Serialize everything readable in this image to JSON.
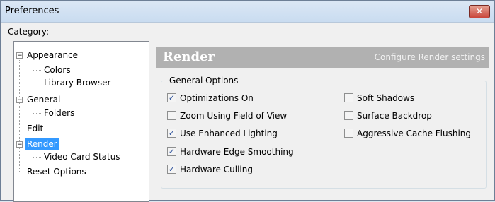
{
  "window": {
    "title": "Preferences",
    "close_glyph": "✕"
  },
  "category_label": "Category:",
  "tree": {
    "items": [
      {
        "label": "Appearance",
        "expander": "−"
      },
      {
        "label": "Colors"
      },
      {
        "label": "Library Browser"
      },
      {
        "label": "General",
        "expander": "−"
      },
      {
        "label": "Folders"
      },
      {
        "label": "Edit"
      },
      {
        "label": "Render",
        "expander": "−",
        "selected": true
      },
      {
        "label": "Video Card Status"
      },
      {
        "label": "Reset Options"
      }
    ]
  },
  "page": {
    "title": "Render",
    "description": "Configure Render settings",
    "header_color": "#b1b1b1"
  },
  "general_options": {
    "label": "General Options",
    "options": [
      {
        "label": "Optimizations On",
        "checked": true
      },
      {
        "label": "Zoom Using Field of View",
        "checked": false
      },
      {
        "label": "Use Enhanced Lighting",
        "checked": true
      },
      {
        "label": "Hardware Edge Smoothing",
        "checked": true
      },
      {
        "label": "Hardware Culling",
        "checked": true
      },
      {
        "label": "Soft Shadows",
        "checked": false
      },
      {
        "label": "Surface Backdrop",
        "checked": false
      },
      {
        "label": "Aggressive Cache Flushing",
        "checked": false
      }
    ]
  },
  "check_glyph": "✓",
  "colors": {
    "selection": "#3399ff",
    "close_button": "#c9453a"
  }
}
